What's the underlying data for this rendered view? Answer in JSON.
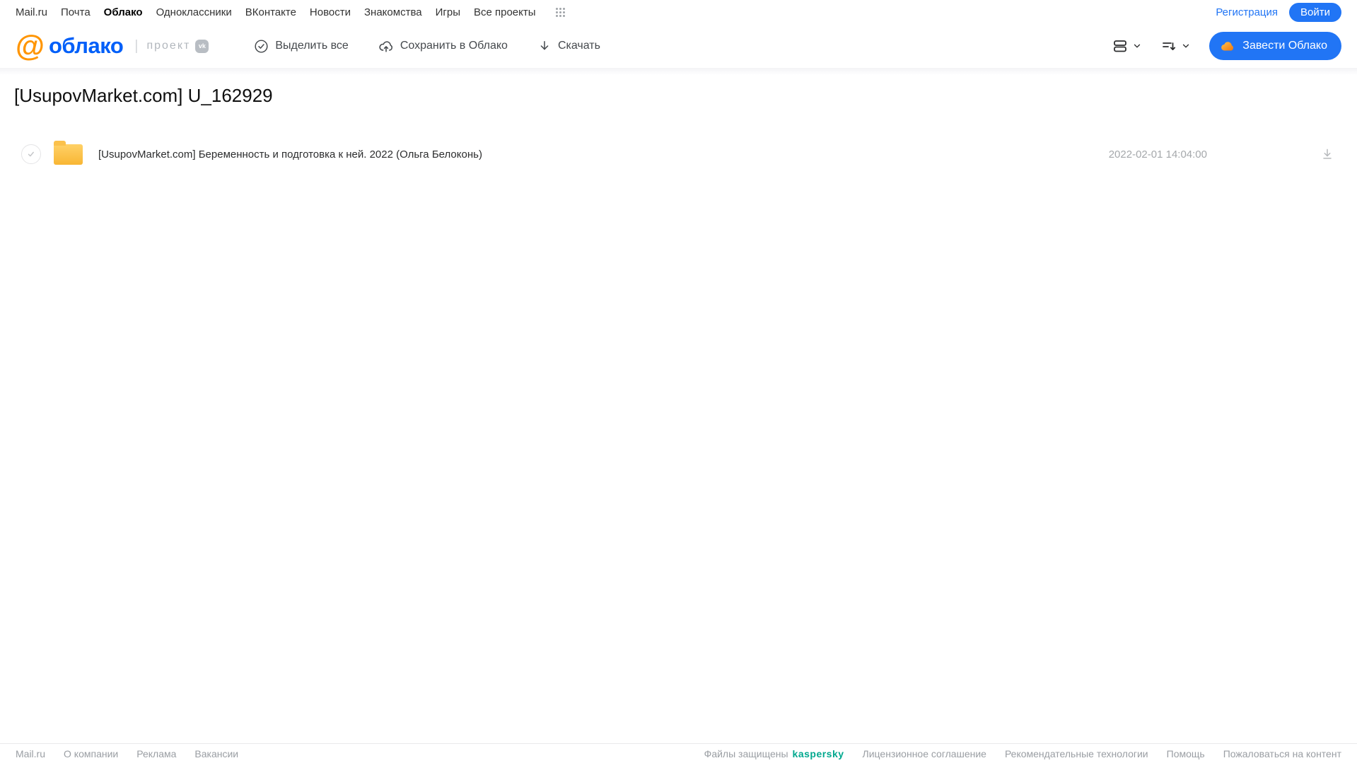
{
  "colors": {
    "accent_blue": "#2175f5",
    "logo_blue": "#005ff9",
    "logo_orange": "#ff9502",
    "folder_yellow": "#f8b634",
    "kaspersky_green": "#00a88e"
  },
  "topnav": {
    "items": [
      {
        "label": "Mail.ru",
        "current": false
      },
      {
        "label": "Почта",
        "current": false
      },
      {
        "label": "Облако",
        "current": true
      },
      {
        "label": "Одноклассники",
        "current": false
      },
      {
        "label": "ВКонтакте",
        "current": false
      },
      {
        "label": "Новости",
        "current": false
      },
      {
        "label": "Знакомства",
        "current": false
      },
      {
        "label": "Игры",
        "current": false
      },
      {
        "label": "Все проекты",
        "current": false
      }
    ],
    "registration_label": "Регистрация",
    "login_label": "Войти"
  },
  "header": {
    "logo_text": "облако",
    "logo_at": "@",
    "project_label": "проект",
    "vk_badge": "vk",
    "toolbar": [
      {
        "label": "Выделить все",
        "icon": "check-circle-icon"
      },
      {
        "label": "Сохранить в Облако",
        "icon": "cloud-upload-icon"
      },
      {
        "label": "Скачать",
        "icon": "download-icon"
      }
    ],
    "get_cloud_label": "Завести Облако"
  },
  "main": {
    "title": "[UsupovMarket.com] U_162929",
    "files": [
      {
        "type": "folder",
        "name": "[UsupovMarket.com] Беременность и подготовка к ней. 2022 (Ольга Белоконь)",
        "date": "2022-02-01 14:04:00"
      }
    ]
  },
  "footer": {
    "left": [
      {
        "label": "Mail.ru"
      },
      {
        "label": "О компании"
      },
      {
        "label": "Реклама"
      },
      {
        "label": "Вакансии"
      }
    ],
    "protected_label": "Файлы защищены",
    "kaspersky_label": "kaspersky",
    "right": [
      {
        "label": "Лицензионное соглашение"
      },
      {
        "label": "Рекомендательные технологии"
      },
      {
        "label": "Помощь"
      },
      {
        "label": "Пожаловаться на контент"
      }
    ]
  }
}
